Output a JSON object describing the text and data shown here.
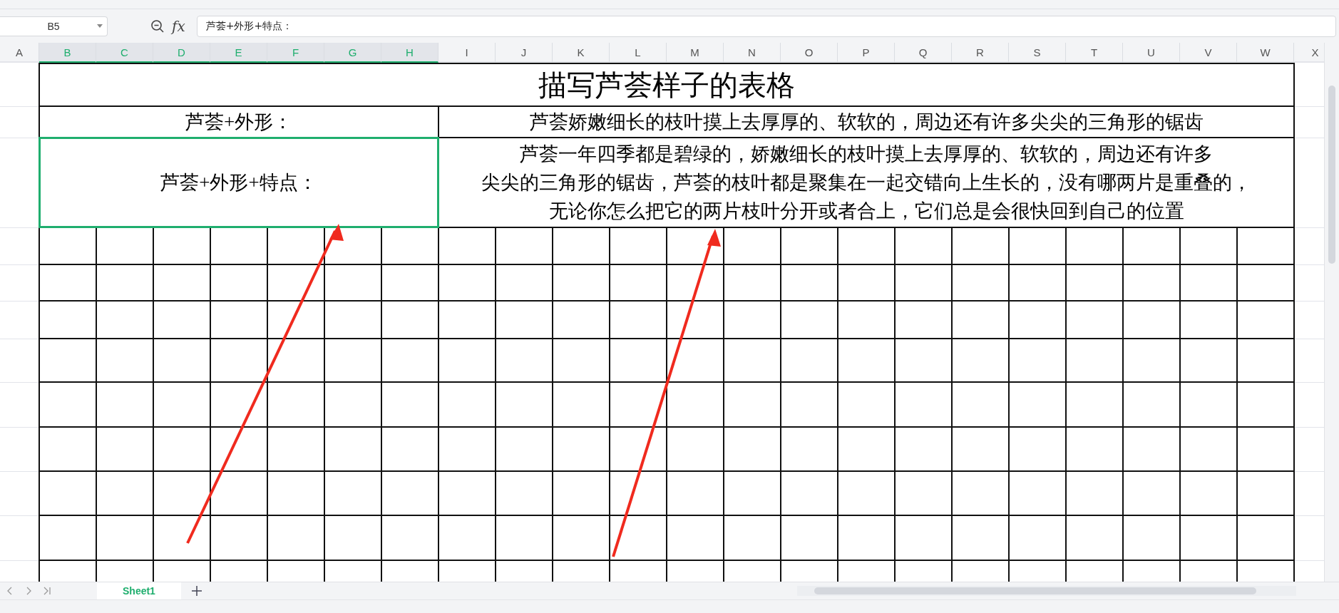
{
  "formula_bar": {
    "name_box": "B5",
    "function_label": "fx",
    "formula": "芦荟+外形+特点："
  },
  "columns": [
    {
      "label": "A",
      "selected": false
    },
    {
      "label": "B",
      "selected": true
    },
    {
      "label": "C",
      "selected": true
    },
    {
      "label": "D",
      "selected": true
    },
    {
      "label": "E",
      "selected": true
    },
    {
      "label": "F",
      "selected": true
    },
    {
      "label": "G",
      "selected": true
    },
    {
      "label": "H",
      "selected": true
    },
    {
      "label": "I",
      "selected": false
    },
    {
      "label": "J",
      "selected": false
    },
    {
      "label": "K",
      "selected": false
    },
    {
      "label": "L",
      "selected": false
    },
    {
      "label": "M",
      "selected": false
    },
    {
      "label": "N",
      "selected": false
    },
    {
      "label": "O",
      "selected": false
    },
    {
      "label": "P",
      "selected": false
    },
    {
      "label": "Q",
      "selected": false
    },
    {
      "label": "R",
      "selected": false
    },
    {
      "label": "S",
      "selected": false
    },
    {
      "label": "T",
      "selected": false
    },
    {
      "label": "U",
      "selected": false
    },
    {
      "label": "V",
      "selected": false
    },
    {
      "label": "W",
      "selected": false
    },
    {
      "label": "X",
      "selected": false
    }
  ],
  "sheet": {
    "title": "描写芦荟样子的表格",
    "rows": [
      {
        "label": "芦荟+外形：",
        "selected": false,
        "lines": [
          "芦荟娇嫩细长的枝叶摸上去厚厚的、软软的，周边还有许多尖尖的三角形的锯齿"
        ]
      },
      {
        "label": "芦荟+外形+特点：",
        "selected": true,
        "lines": [
          "芦荟一年四季都是碧绿的，娇嫩细长的枝叶摸上去厚厚的、软软的，周边还有许多",
          "尖尖的三角形的锯齿，芦荟的枝叶都是聚集在一起交错向上生长的，没有哪两片是重叠的，",
          "无论你怎么把它的两片枝叶分开或者合上，它们总是会很快回到自己的位置"
        ]
      }
    ]
  },
  "sheet_tabs": [
    {
      "label": "Sheet1",
      "selected": true
    }
  ]
}
